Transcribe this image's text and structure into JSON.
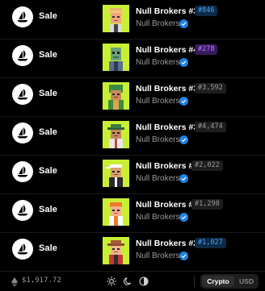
{
  "events": [
    {
      "event": "Sale",
      "name": "Null Brokers #38",
      "rank": "#846",
      "rank_color": "blue",
      "collection": "Null Brokers",
      "variant": "blonde-cap"
    },
    {
      "event": "Sale",
      "name": "Null Brokers #40",
      "rank": "#278",
      "rank_color": "purple",
      "collection": "Null Brokers",
      "variant": "green-robot"
    },
    {
      "event": "Sale",
      "name": "Null Brokers #30",
      "rank": "#3,592",
      "rank_color": "gray",
      "collection": "Null Brokers",
      "variant": "green-hood"
    },
    {
      "event": "Sale",
      "name": "Null Brokers #36",
      "rank": "#4,474",
      "rank_color": "gray",
      "collection": "Null Brokers",
      "variant": "green-hat"
    },
    {
      "event": "Sale",
      "name": "Null Brokers #41",
      "rank": "#2,022",
      "rank_color": "gray",
      "collection": "Null Brokers",
      "variant": "white-cap"
    },
    {
      "event": "Sale",
      "name": "Null Brokers #15",
      "rank": "#1,298",
      "rank_color": "gray",
      "collection": "Null Brokers",
      "variant": "orange-hair"
    },
    {
      "event": "Sale",
      "name": "Null Brokers #22",
      "rank": "#1,027",
      "rank_color": "blue",
      "collection": "Null Brokers",
      "variant": "brown-hat"
    }
  ],
  "footer": {
    "price": "$1,917.72",
    "currency_options": [
      "Crypto",
      "USD"
    ],
    "selected_currency": "Crypto"
  },
  "colors": {
    "accent_blue": "#2081e2",
    "thumb_bg": "#c8ef34",
    "background": "#000000"
  },
  "icons": {
    "marketplace": "opensea-ship-icon",
    "verified": "verified-check-icon",
    "eth": "ethereum-icon",
    "light_theme": "sun-icon",
    "dark_theme": "moon-icon",
    "auto_theme": "half-circle-icon"
  }
}
